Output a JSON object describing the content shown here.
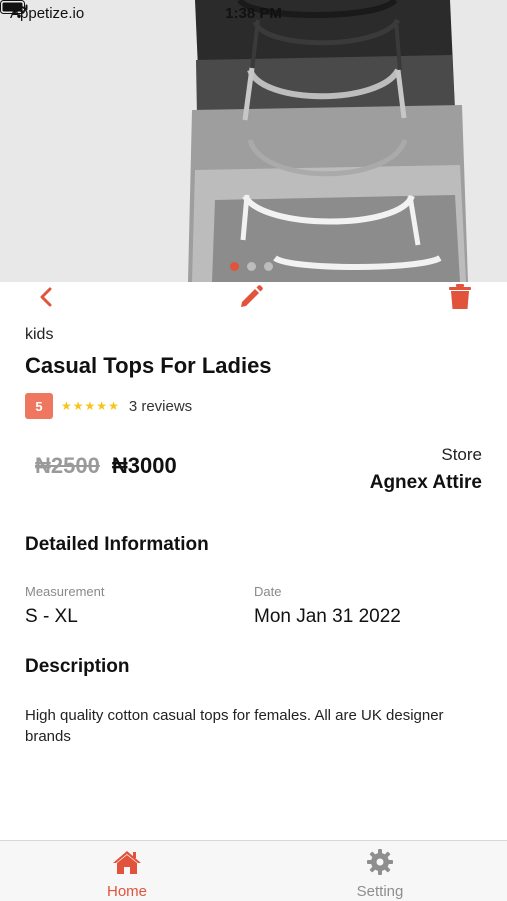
{
  "status_bar": {
    "carrier": "Appetize.io",
    "time": "1:38 PM"
  },
  "colors": {
    "accent": "#e2533c",
    "badge": "#f0775f",
    "star": "#f5c518",
    "muted": "#8e8e8e"
  },
  "carousel": {
    "active_index": 0,
    "count": 3
  },
  "actions": {
    "back": "chevron-left-icon",
    "edit": "pencil-icon",
    "delete": "trash-icon"
  },
  "product": {
    "category": "kids",
    "title": "Casual Tops For Ladies",
    "rating": "5",
    "stars": 5,
    "reviews": "3 reviews",
    "old_price": "₦2500",
    "price": "₦3000",
    "store_label": "Store",
    "store_name": "Agnex Attire"
  },
  "details": {
    "heading": "Detailed Information",
    "measurement_label": "Measurement",
    "measurement_value": "S - XL",
    "date_label": "Date",
    "date_value": "Mon Jan 31 2022"
  },
  "description": {
    "heading": "Description",
    "text": "High quality cotton casual tops for females. All are UK designer brands"
  },
  "tabbar": {
    "home_label": "Home",
    "setting_label": "Setting",
    "home_icon": "home-icon",
    "setting_icon": "gear-icon"
  }
}
